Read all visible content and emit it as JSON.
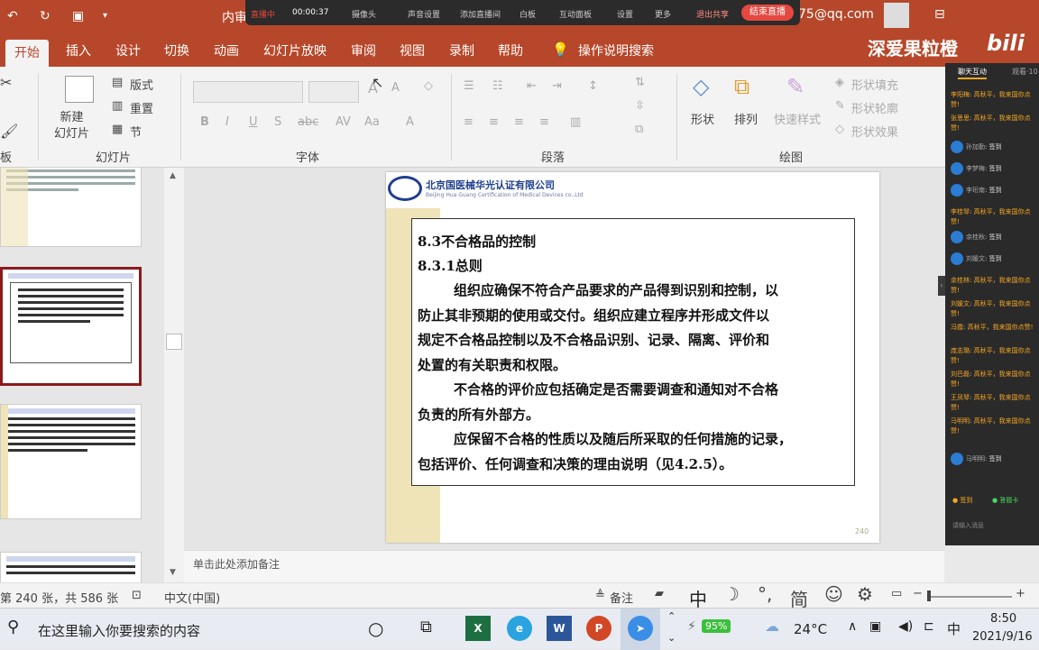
{
  "titlebar": {
    "title": "内审",
    "account_fragment": "75@qq.com",
    "watermark": "深爱果粒橙",
    "bili": "bili"
  },
  "meeting": {
    "status": "直播中",
    "timer": "00:00:37",
    "items": [
      "摄像头",
      "声音设置",
      "添加直播间",
      "白板",
      "互动面板",
      "设置",
      "更多",
      "退出共享"
    ],
    "end_label": "结束直播"
  },
  "tabs": [
    "开始",
    "插入",
    "设计",
    "切换",
    "动画",
    "幻灯片放映",
    "审阅",
    "视图",
    "录制",
    "帮助",
    "操作说明搜索"
  ],
  "ribbon": {
    "new_slide": "新建\n幻灯片",
    "layout": "版式",
    "reset": "重置",
    "section": "节",
    "shape": "形状",
    "arrange": "排列",
    "quick_style": "快速样式",
    "shape_fill": "形状填充",
    "shape_outline": "形状轮廓",
    "shape_effect": "形状效果",
    "groups": [
      "板",
      "幻灯片",
      "字体",
      "段落",
      "绘图"
    ]
  },
  "slide": {
    "company": "北京国医械华光认证有限公司",
    "company_en": "Beijing Hua Guang Certification of Medical Devices co.,Ltd",
    "heading1": "8.3不合格品的控制",
    "heading2": "8.3.1总则",
    "para1_lines": [
      "组织应确保不符合产品要求的产品得到识别和控制，以",
      "防止其非预期的使用或交付。组织应建立程序并形成文件以",
      "规定不合格品控制以及不合格品识别、记录、隔离、评价和",
      "处置的有关职责和权限。"
    ],
    "para2_lines": [
      "不合格的评价应包括确定是否需要调查和通知对不合格",
      "负责的所有外部方。"
    ],
    "para3_lines": [
      "应保留不合格的性质以及随后所采取的任何措施的记录，",
      "包括评价、任何调查和决策的理由说明（见4.2.5）。"
    ],
    "page_number": "240"
  },
  "notes_placeholder": "单击此处添加备注",
  "status": {
    "slide_info": "第 240 张，共 586 张",
    "language": "中文(中国)",
    "notes": "备注",
    "ime": "中",
    "ime_mode": "简"
  },
  "taskbar": {
    "search_placeholder": "在这里输入你要搜索的内容",
    "battery": "95%",
    "weather": "24°C",
    "ime": "中",
    "time": "8:50",
    "date": "2021/9/16"
  },
  "chat": {
    "tabs": [
      "聊天互动",
      "观看·10"
    ],
    "messages": [
      {
        "name": "李阳梅",
        "text": "高秋平，我来国你点赞!"
      },
      {
        "name": "张思思",
        "text": "高秋平，我来国你点赞!"
      },
      {
        "name": "孙加勤",
        "text": "签到"
      },
      {
        "name": "李梦梅",
        "text": "签到"
      },
      {
        "name": "李珩南",
        "text": "签到"
      },
      {
        "name": "李桂琴",
        "text": "高秋平，我来国你点赞!"
      },
      {
        "name": "余桂秋",
        "text": "签到"
      },
      {
        "name": "刘媛文",
        "text": "签到"
      },
      {
        "name": "余桂林",
        "text": "高秋平，我来国你点赞!"
      },
      {
        "name": "刘媛文",
        "text": "高秋平，我来国你点赞!"
      },
      {
        "name": "冯霞",
        "text": "高秋平，我来国你点赞!"
      },
      {
        "name": "庞志璐",
        "text": "高秋平，我来国你点赞!"
      },
      {
        "name": "刘巴磊",
        "text": "高秋平，我来国你点赞!"
      },
      {
        "name": "王凤琴",
        "text": "高秋平，我来国你点赞!"
      },
      {
        "name": "马明明",
        "text": "高秋平，我来国你点赞!"
      },
      {
        "name": "马明明",
        "text": "签到"
      }
    ],
    "btn_signin": "签到",
    "btn_card": "答题卡",
    "input_placeholder": "请输入消息"
  }
}
